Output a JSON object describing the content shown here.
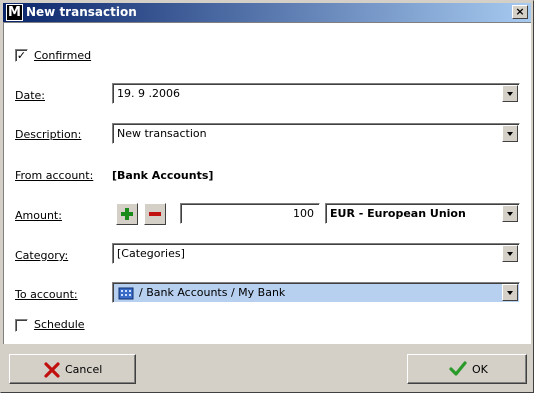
{
  "window": {
    "app_icon_letter": "M",
    "title": "New transaction",
    "close_glyph": "×"
  },
  "form": {
    "confirmed": {
      "label": "Confirmed",
      "checked": true,
      "check_glyph": "✓"
    },
    "date": {
      "label": "Date:",
      "value": "19. 9 .2006"
    },
    "description": {
      "label": "Description:",
      "value": "New transaction"
    },
    "from_account": {
      "label": "From account:",
      "value": "[Bank Accounts]"
    },
    "amount": {
      "label": "Amount:",
      "value": "100",
      "currency": "EUR - European Union",
      "plus_icon": "plus-icon",
      "minus_icon": "minus-icon"
    },
    "category": {
      "label": "Category:",
      "value": "[Categories]"
    },
    "to_account": {
      "label": "To account:",
      "value": "/ Bank Accounts / My Bank",
      "icon": "bank-icon"
    },
    "schedule": {
      "label": "Schedule",
      "checked": false
    }
  },
  "buttons": {
    "cancel": {
      "label": "Cancel",
      "icon": "x-icon"
    },
    "ok": {
      "label": "OK",
      "icon": "checkmark-icon"
    }
  },
  "colors": {
    "title_gradient_start": "#0a246a",
    "title_gradient_end": "#a6caf0",
    "selected_field": "#b8d0f0",
    "plus_green": "#1a8a1a",
    "minus_red": "#c01010",
    "cancel_x_red": "#c01010",
    "ok_check_green": "#2a9a2a"
  }
}
